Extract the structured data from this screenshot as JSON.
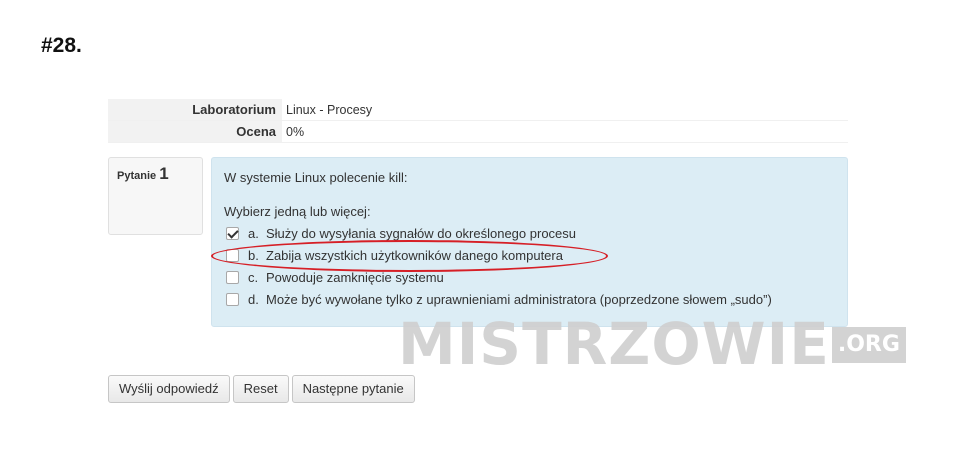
{
  "post_number": "#28.",
  "info": {
    "rows": [
      {
        "label": "Laboratorium",
        "value": "Linux - Procesy"
      },
      {
        "label": "Ocena",
        "value": "0%"
      }
    ]
  },
  "question": {
    "label": "Pytanie",
    "number": "1",
    "text": "W systemie Linux polecenie kill:",
    "prompt": "Wybierz jedną lub więcej:",
    "answers": [
      {
        "letter": "a.",
        "text": "Służy do wysyłania sygnałów do określonego procesu",
        "checked": true
      },
      {
        "letter": "b.",
        "text": "Zabija wszystkich użytkowników danego komputera",
        "checked": false
      },
      {
        "letter": "c.",
        "text": "Powoduje zamknięcie systemu",
        "checked": false
      },
      {
        "letter": "d.",
        "text": "Może być wywołane tylko z uprawnieniami administratora (poprzedzone słowem „sudo”)",
        "checked": false
      }
    ]
  },
  "watermark": {
    "main": "MISTRZOWIE",
    "suffix": ".ORG"
  },
  "buttons": {
    "submit": "Wyślij odpowiedź",
    "reset": "Reset",
    "next": "Następne pytanie"
  },
  "colors": {
    "question_bg": "#dcedf5",
    "highlight": "#d61f26"
  }
}
